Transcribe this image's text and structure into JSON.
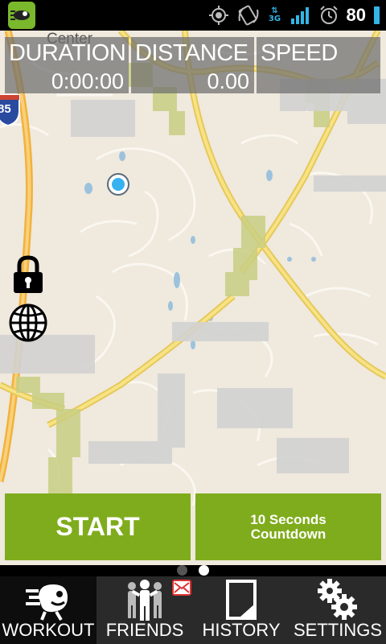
{
  "status_bar": {
    "app_icon": "runner-app-icon",
    "icons": [
      "gps-icon",
      "rotation-icon",
      "data-3g-icon",
      "signal-icon",
      "alarm-icon"
    ],
    "network_label": "3G",
    "battery_percent": "80"
  },
  "map": {
    "place_label": "Center",
    "highway_shield": "85",
    "background_color": "#efe9de",
    "road_color": "#f7d655"
  },
  "stats": [
    {
      "label": "DURATION",
      "value": "0:00:00"
    },
    {
      "label": "DISTANCE",
      "value": "0.00"
    },
    {
      "label": "SPEED",
      "value": ""
    }
  ],
  "map_controls": {
    "lock_icon": "lock-icon",
    "layers_icon": "globe-icon"
  },
  "actions": {
    "start_label": "START",
    "countdown_label": "10 Seconds\nCountdown",
    "accent_color": "#7fac1c"
  },
  "pager": {
    "pages": 2,
    "current": 2
  },
  "nav": [
    {
      "label": "WORKOUT",
      "icon": "runner-icon",
      "active": true
    },
    {
      "label": "FRIENDS",
      "icon": "friends-icon",
      "active": false
    },
    {
      "label": "HISTORY",
      "icon": "history-icon",
      "active": false
    },
    {
      "label": "SETTINGS",
      "icon": "gears-icon",
      "active": false
    }
  ]
}
